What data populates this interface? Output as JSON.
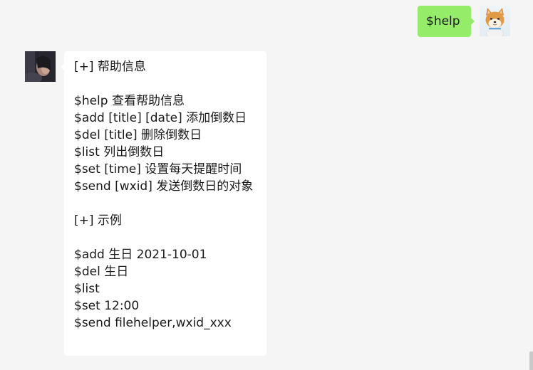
{
  "messages": {
    "outgoing": {
      "text": "$help",
      "avatar_icon": "shiba-dog-avatar-icon",
      "bubble_color": "#95ec69"
    },
    "incoming": {
      "avatar_icon": "user-photo-avatar-icon",
      "bubble_color": "#ffffff",
      "lines": [
        "[+] 帮助信息",
        "",
        "$help 查看帮助信息",
        "$add [title] [date] 添加倒数日",
        "$del [title] 删除倒数日",
        "$list 列出倒数日",
        "$set [time] 设置每天提醒时间",
        "$send [wxid] 发送倒数日的对象",
        "",
        "[+] 示例",
        "",
        "$add 生日 2021-10-01",
        "$del 生日",
        "$list",
        "$set 12:00",
        "$send filehelper,wxid_xxx"
      ]
    }
  },
  "theme": {
    "background": "#f5f5f5"
  }
}
